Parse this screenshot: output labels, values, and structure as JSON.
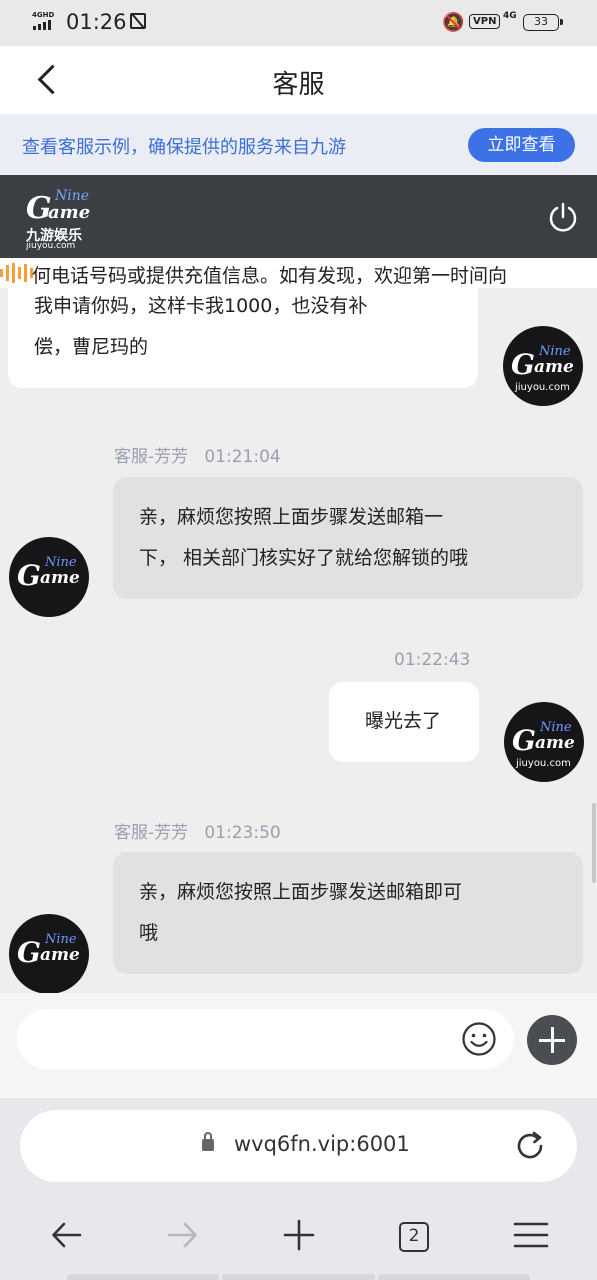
{
  "status_bar": {
    "network_label": "4GHD",
    "time": "01:26",
    "vpn_label": "VPN",
    "signal_label": "4G",
    "battery": "33"
  },
  "header": {
    "title": "客服"
  },
  "banner": {
    "text": "查看客服示例，确保提供的服务来自九游",
    "button_label": "立即查看",
    "accent_color": "#3d72e6"
  },
  "brand": {
    "logo_nine": "Nine",
    "logo_g": "G",
    "logo_ame": "ame",
    "logo_cn": "九游娱乐",
    "logo_url": "jiuyou.com"
  },
  "marquee": {
    "text": "何电话号码或提供充值信息。如有发现，欢迎第一时间向"
  },
  "messages": [
    {
      "sender": "user",
      "lines": [
        "我申请你妈，这样卡我1000，也没有补",
        "偿，曹尼玛的"
      ]
    },
    {
      "sender": "agent",
      "name": "客服-芳芳",
      "time": "01:21:04",
      "lines": [
        "亲，麻烦您按照上面步骤发送邮箱一",
        "下， 相关部门核实好了就给您解锁的哦"
      ]
    },
    {
      "sender": "user",
      "time": "01:22:43",
      "lines": [
        "曝光去了"
      ]
    },
    {
      "sender": "agent",
      "name": "客服-芳芳",
      "time": "01:23:50",
      "lines": [
        "亲，麻烦您按照上面步骤发送邮箱即可",
        "哦"
      ]
    }
  ],
  "input": {
    "placeholder": ""
  },
  "browser": {
    "url": "wvq6fn.vip:6001",
    "tab_count": "2"
  }
}
